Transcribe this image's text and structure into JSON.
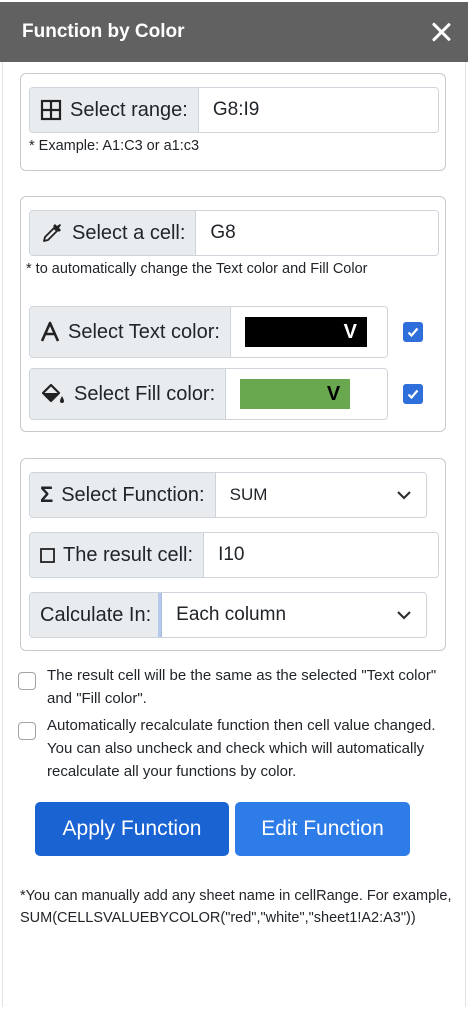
{
  "title": "Function by Color",
  "range_group": {
    "label": "Select range:",
    "value": "G8:I9",
    "hint": "* Example: A1:C3 or a1:c3"
  },
  "cell_group": {
    "cell_label": "Select a cell:",
    "cell_value": "G8",
    "hint": "* to automatically change the Text color and Fill Color",
    "text_color_label": "Select Text color:",
    "text_color_value": "#000000",
    "text_color_marker": "V",
    "text_color_checked": true,
    "fill_color_label": "Select Fill color:",
    "fill_color_value": "#6aa84f",
    "fill_color_marker": "V",
    "fill_color_checked": true
  },
  "function_group": {
    "function_label": "Select Function:",
    "function_value": "SUM",
    "result_label": "The result cell:",
    "result_value": "I10",
    "calc_label": "Calculate In:",
    "calc_value": "Each column"
  },
  "options": [
    {
      "text": "The result cell will be the same as the selected \"Text color\" and \"Fill color\".",
      "checked": false
    },
    {
      "text": "Automatically recalculate function then cell value changed. You can also uncheck and check which will automatically recalculate all your functions by color.",
      "checked": false
    }
  ],
  "buttons": {
    "apply": "Apply Function",
    "edit": "Edit Function"
  },
  "footnote": "*You can manually add any sheet name in cellRange. For example, SUM(CELLSVALUEBYCOLOR(\"red\",\"white\",\"sheet1!A2:A3\"))",
  "colors": {
    "titlebar": "#616161",
    "primary": "#1a63d3",
    "checkbox": "#2e6fdb"
  }
}
